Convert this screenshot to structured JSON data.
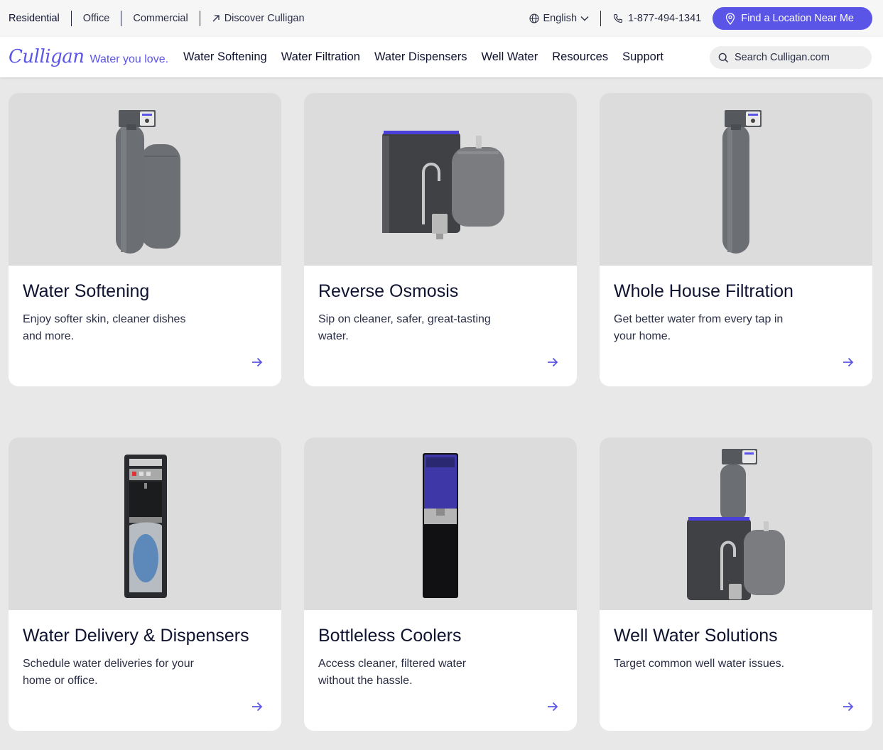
{
  "utility_bar": {
    "links": [
      "Residential",
      "Office",
      "Commercial",
      "Discover Culligan"
    ],
    "language": "English",
    "phone": "1-877-494-1341",
    "cta": "Find a Location Near Me"
  },
  "nav": {
    "logo": "Culligan",
    "tagline": "Water you love.",
    "links": [
      "Water Softening",
      "Water Filtration",
      "Water Dispensers",
      "Well Water",
      "Resources",
      "Support"
    ],
    "search_placeholder": "Search Culligan.com"
  },
  "cards": [
    {
      "title": "Water Softening",
      "desc": "Enjoy softer skin, cleaner dishes and more."
    },
    {
      "title": "Reverse Osmosis",
      "desc": "Sip on cleaner, safer, great-tasting water."
    },
    {
      "title": "Whole House Filtration",
      "desc": "Get better water from every tap in your home."
    },
    {
      "title": "Water Delivery & Dispensers",
      "desc": "Schedule water deliveries for your home or office."
    },
    {
      "title": "Bottleless Coolers",
      "desc": "Access cleaner, filtered water without the hassle."
    },
    {
      "title": "Well Water Solutions",
      "desc": "Target common well water issues."
    }
  ],
  "colors": {
    "accent": "#5a55e6",
    "text": "#0f1330",
    "card_image_bg": "#dcdcdc",
    "page_bg": "#e8e8e8"
  },
  "icons": [
    "arrow-up-right-icon",
    "globe-icon",
    "chevron-down-icon",
    "phone-icon",
    "location-pin-icon",
    "search-icon",
    "arrow-right-icon"
  ]
}
